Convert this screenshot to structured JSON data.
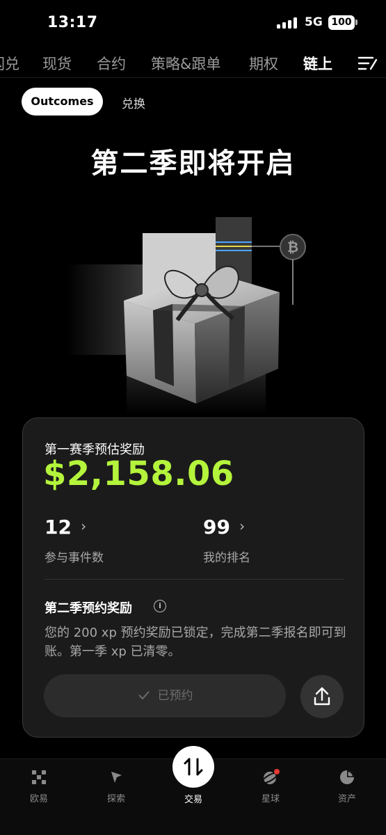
{
  "status_bar": {
    "time": "13:17",
    "network": "5G",
    "battery": "100"
  },
  "top_nav": {
    "tabs": [
      "闪兑",
      "现货",
      "合约",
      "策略&跟单",
      "期权",
      "链上"
    ],
    "active": "链上"
  },
  "sub_tabs": {
    "active": "Outcomes",
    "other": "兑换"
  },
  "headline": "第二季即将开启",
  "card": {
    "title": "第一赛季预估奖励",
    "amount": "$2,158.06",
    "events_value": "12",
    "events_label": "参与事件数",
    "rank_value": "99",
    "rank_label": "我的排名",
    "section_title": "第二季预约奖励",
    "description": "您的 200 xp 预约奖励已锁定，完成第二季报名即可到账。第一季 xp 已清零。",
    "reserved_label": "已预约"
  },
  "bottom_nav": {
    "items": [
      "欧易",
      "探索",
      "交易",
      "星球",
      "资产"
    ]
  },
  "colors": {
    "accent": "#b4f43c",
    "badge": "#e53935"
  },
  "icons": [
    "okx-logo-icon",
    "explore-icon",
    "trade-swap-icon",
    "planet-icon",
    "assets-pie-icon",
    "share-icon",
    "info-icon",
    "check-icon",
    "chevron-right-icon",
    "menu-icon",
    "bitcoin-icon"
  ]
}
